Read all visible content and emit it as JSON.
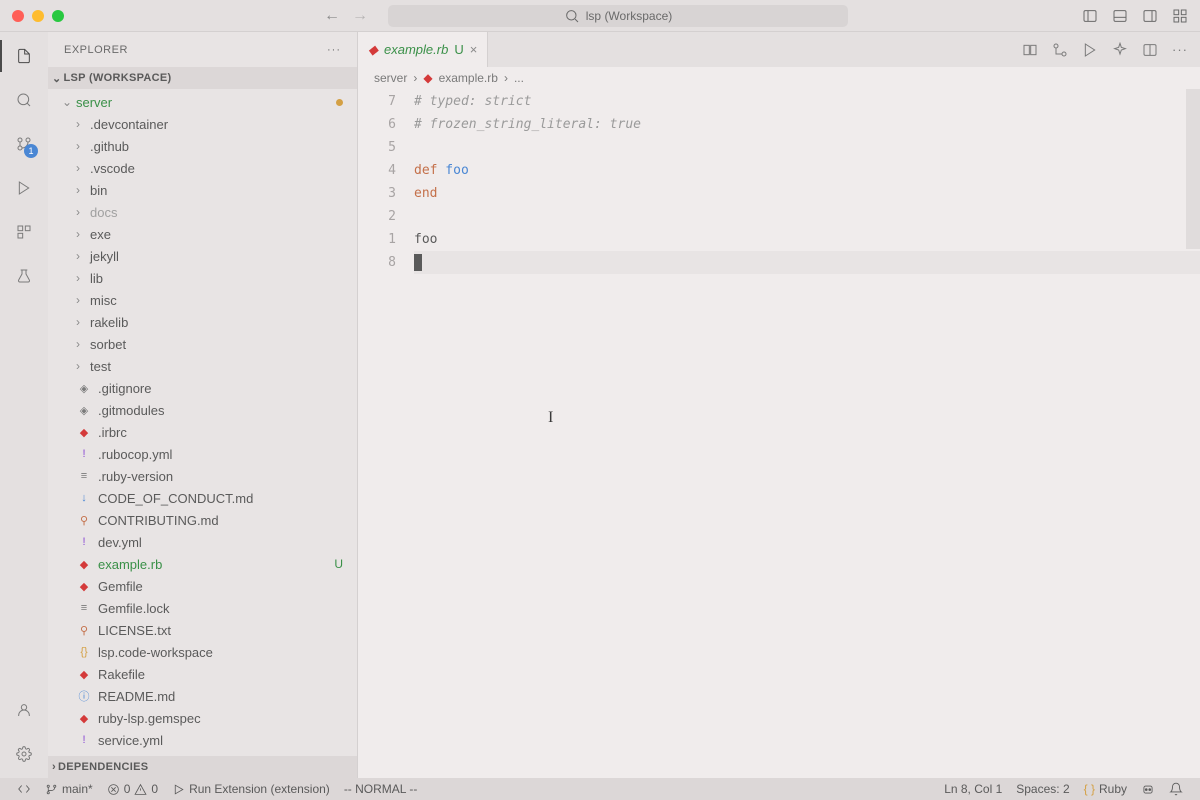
{
  "titlebar": {
    "search_placeholder": "lsp (Workspace)"
  },
  "activity": {
    "scm_badge": "1"
  },
  "sidebar": {
    "title": "EXPLORER",
    "workspace_label": "LSP (WORKSPACE)",
    "root": "server",
    "folders": [
      {
        "name": ".devcontainer"
      },
      {
        "name": ".github"
      },
      {
        "name": ".vscode"
      },
      {
        "name": "bin"
      },
      {
        "name": "docs",
        "muted": true
      },
      {
        "name": "exe"
      },
      {
        "name": "jekyll"
      },
      {
        "name": "lib"
      },
      {
        "name": "misc"
      },
      {
        "name": "rakelib"
      },
      {
        "name": "sorbet"
      },
      {
        "name": "test"
      }
    ],
    "files": [
      {
        "name": ".gitignore",
        "icon": "git"
      },
      {
        "name": ".gitmodules",
        "icon": "git"
      },
      {
        "name": ".irbrc",
        "icon": "ruby"
      },
      {
        "name": ".rubocop.yml",
        "icon": "yaml"
      },
      {
        "name": ".ruby-version",
        "icon": "txt"
      },
      {
        "name": "CODE_OF_CONDUCT.md",
        "icon": "md"
      },
      {
        "name": "CONTRIBUTING.md",
        "icon": "code"
      },
      {
        "name": "dev.yml",
        "icon": "yaml"
      },
      {
        "name": "example.rb",
        "icon": "ruby",
        "active": true,
        "status": "U"
      },
      {
        "name": "Gemfile",
        "icon": "ruby"
      },
      {
        "name": "Gemfile.lock",
        "icon": "txt"
      },
      {
        "name": "LICENSE.txt",
        "icon": "code"
      },
      {
        "name": "lsp.code-workspace",
        "icon": "json"
      },
      {
        "name": "Rakefile",
        "icon": "ruby"
      },
      {
        "name": "README.md",
        "icon": "md-info"
      },
      {
        "name": "ruby-lsp.gemspec",
        "icon": "ruby"
      },
      {
        "name": "service.yml",
        "icon": "yaml"
      }
    ],
    "deps_label": "DEPENDENCIES"
  },
  "tab": {
    "label": "example.rb",
    "status": "U"
  },
  "breadcrumb": {
    "part1": "server",
    "part2": "example.rb",
    "part3": "..."
  },
  "editor": {
    "gutter": [
      "7",
      "6",
      "5",
      "4",
      "3",
      "2",
      "1",
      "8"
    ],
    "lines": [
      {
        "t": "comment",
        "text": "# typed: strict"
      },
      {
        "t": "comment",
        "text": "# frozen_string_literal: true"
      },
      {
        "t": "blank",
        "text": ""
      },
      {
        "t": "def",
        "kw": "def",
        "name": " foo"
      },
      {
        "t": "kw",
        "text": "end"
      },
      {
        "t": "blank",
        "text": ""
      },
      {
        "t": "plain",
        "text": "foo"
      },
      {
        "t": "cursor",
        "text": ""
      }
    ]
  },
  "status": {
    "branch": "main*",
    "errors": "0",
    "warnings": "0",
    "debug": "Run Extension (extension)",
    "mode": "-- NORMAL --",
    "position": "Ln 8, Col 1",
    "spaces": "Spaces: 2",
    "language": "Ruby"
  }
}
